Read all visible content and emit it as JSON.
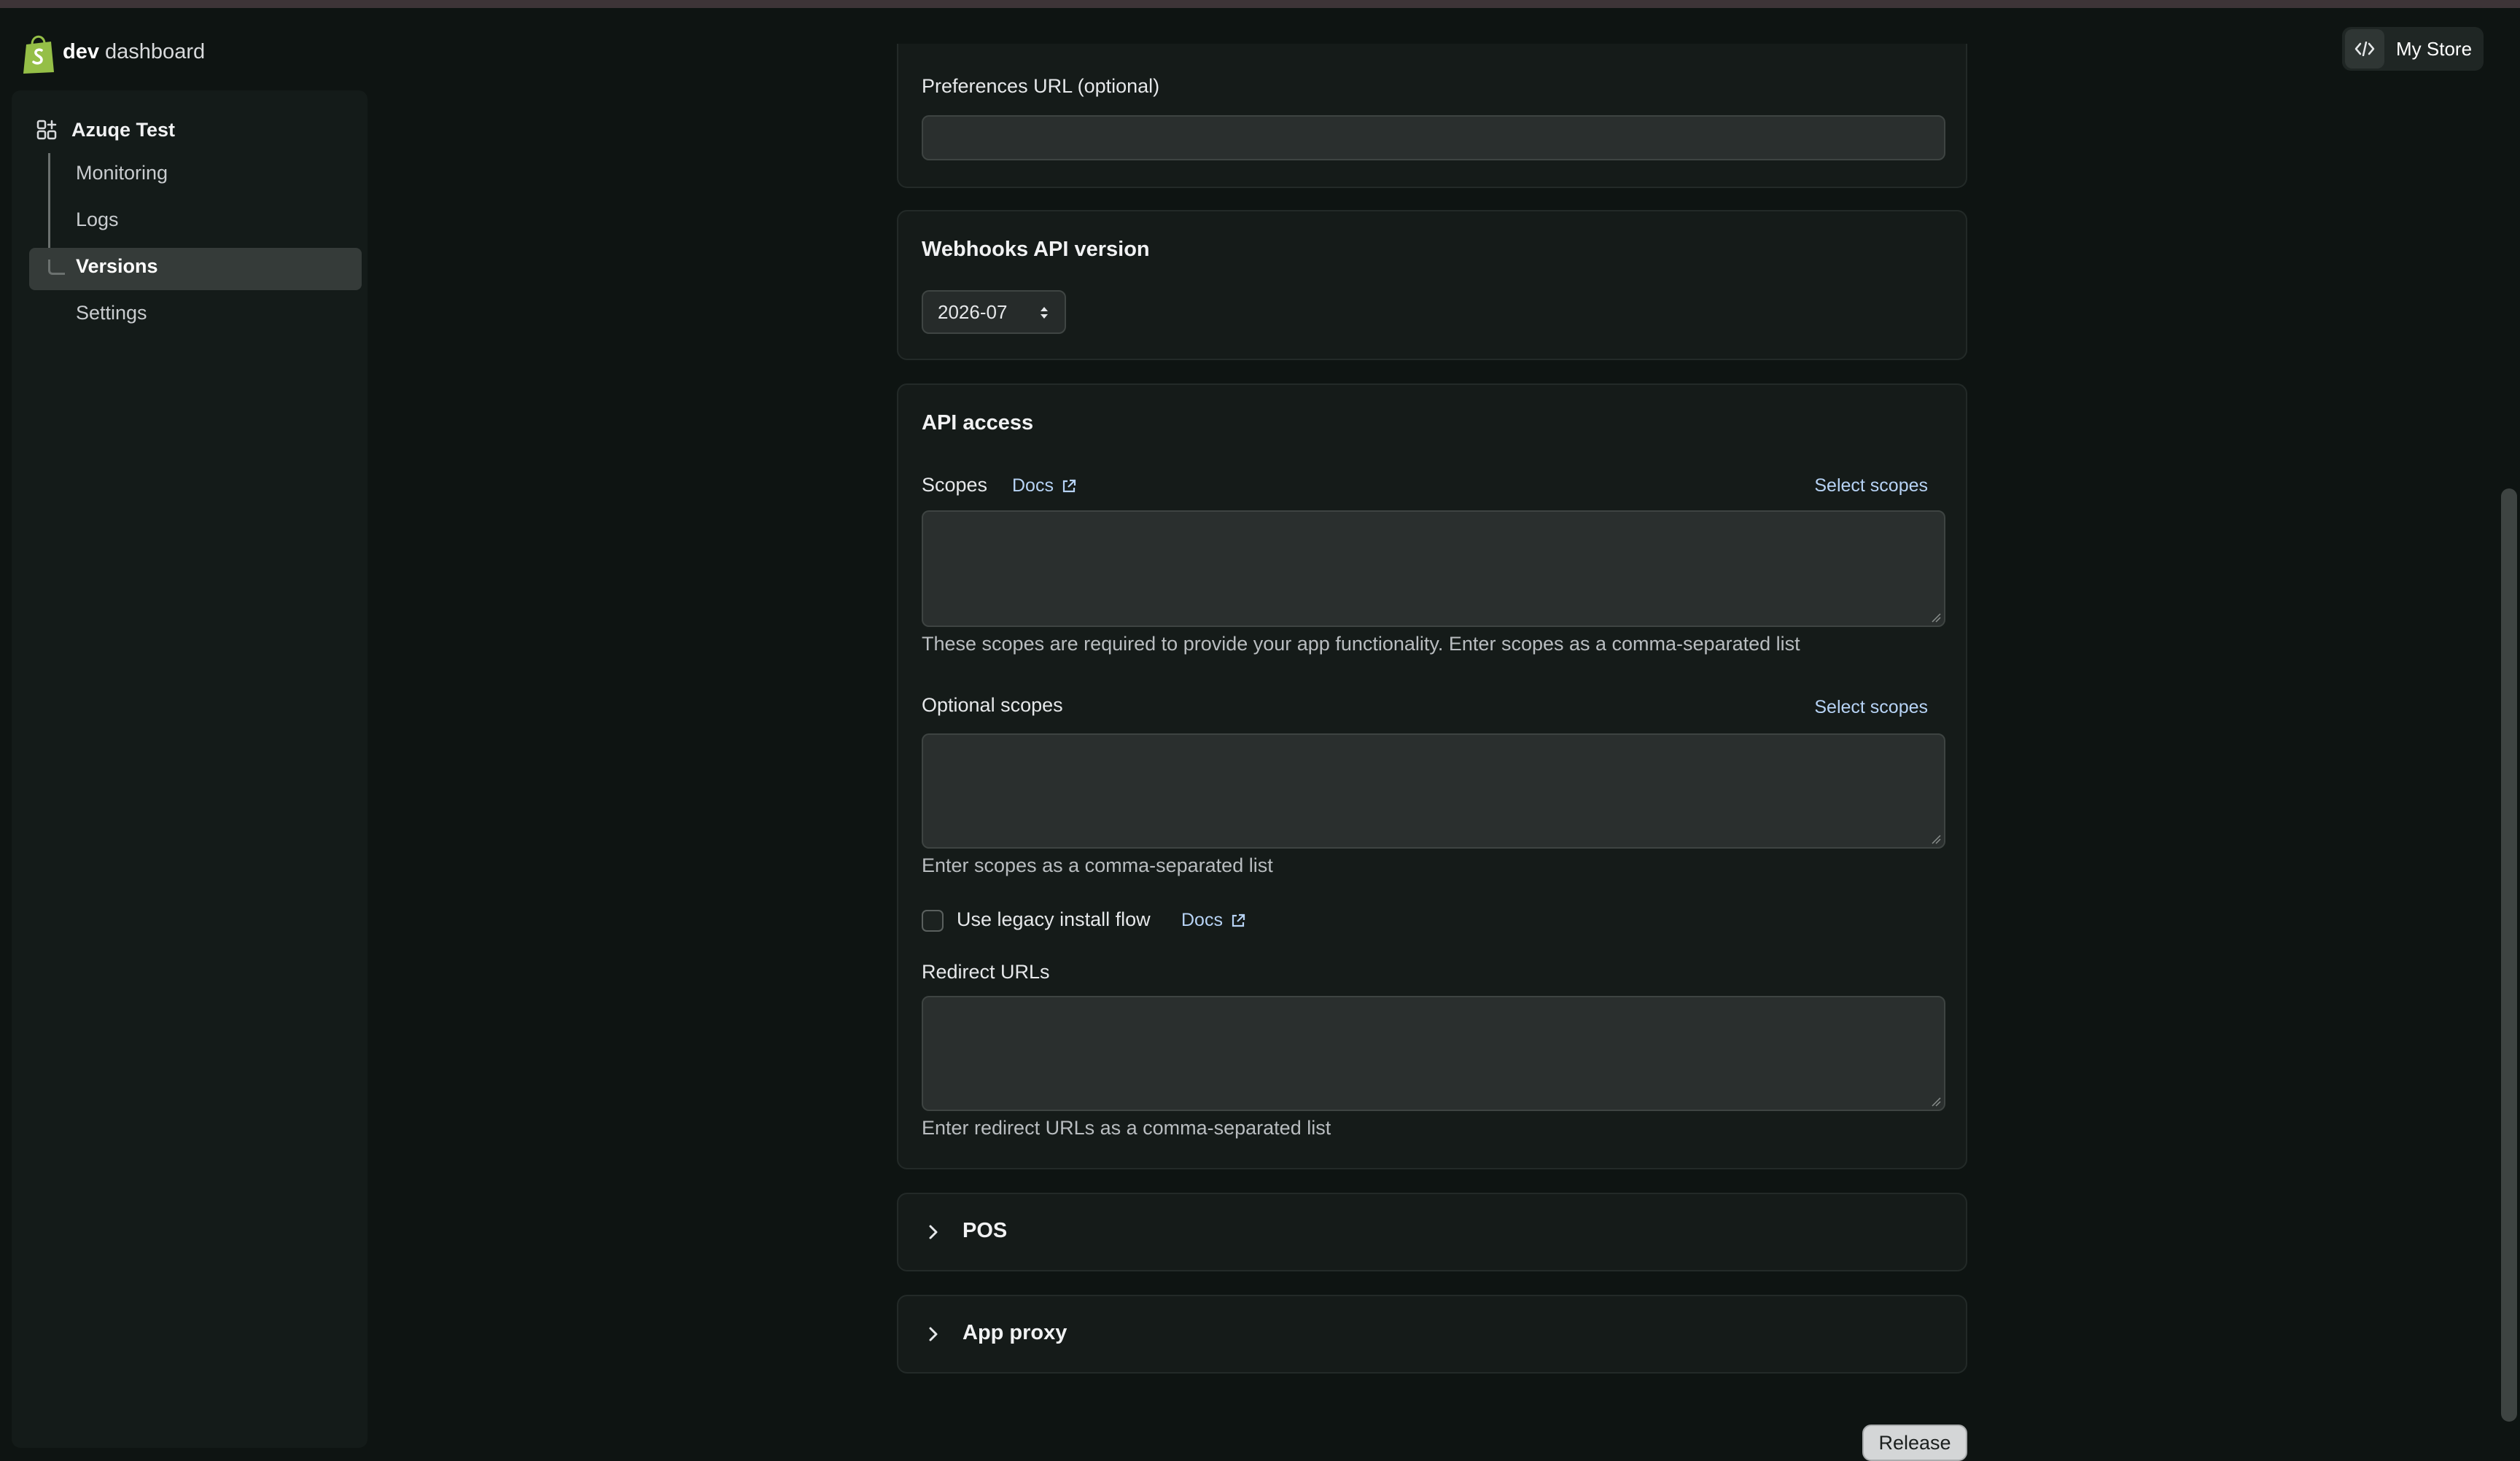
{
  "header": {
    "brand_bold": "dev",
    "brand_rest": "dashboard",
    "store_label": "My Store",
    "store_icon": "code-icon",
    "logo_icon": "shopify-bag-icon"
  },
  "sidebar": {
    "app_name": "Azuqe Test",
    "app_icon": "apps-grid-icon",
    "items": [
      {
        "label": "Monitoring"
      },
      {
        "label": "Logs"
      },
      {
        "label": "Versions",
        "active": true
      },
      {
        "label": "Settings"
      }
    ]
  },
  "preferences": {
    "label": "Preferences URL (optional)",
    "value": ""
  },
  "webhooks": {
    "title": "Webhooks API version",
    "selected": "2026-07"
  },
  "api_access": {
    "title": "API access",
    "scopes": {
      "label": "Scopes",
      "docs": "Docs",
      "select": "Select scopes",
      "value": "",
      "help": "These scopes are required to provide your app functionality. Enter scopes as a comma-separated list"
    },
    "optional_scopes": {
      "label": "Optional scopes",
      "select": "Select scopes",
      "value": "",
      "help": "Enter scopes as a comma-separated list"
    },
    "legacy": {
      "label": "Use legacy install flow",
      "docs": "Docs",
      "checked": false
    },
    "redirect": {
      "label": "Redirect URLs",
      "value": "",
      "help": "Enter redirect URLs as a comma-separated list"
    }
  },
  "sections": {
    "pos": "POS",
    "app_proxy": "App proxy"
  },
  "actions": {
    "release": "Release"
  },
  "colors": {
    "background": "#0e1412",
    "card": "#151b19",
    "link": "#b7d3f5",
    "brand_green": "#95bf47"
  }
}
